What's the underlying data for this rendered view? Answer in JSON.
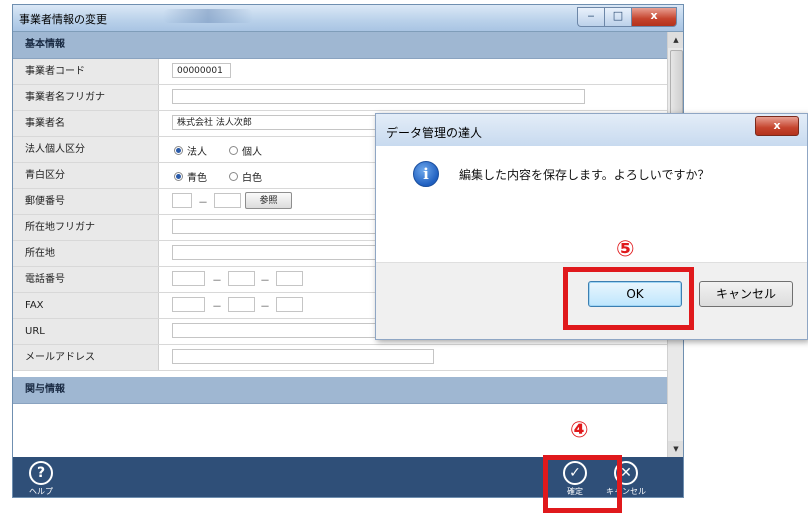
{
  "window": {
    "title": "事業者情報の変更",
    "buttons": {
      "minimize": "‒",
      "maximize": "□",
      "close": "x"
    }
  },
  "sections": {
    "basic": "基本情報",
    "kanyo": "関与情報"
  },
  "fields": {
    "code": {
      "label": "事業者コード",
      "value": "00000001"
    },
    "kana": {
      "label": "事業者名フリガナ",
      "value": ""
    },
    "name": {
      "label": "事業者名",
      "value": "株式会社 法人次郎"
    },
    "type": {
      "label": "法人個人区分",
      "opt1": "法人",
      "opt2": "個人"
    },
    "color": {
      "label": "青白区分",
      "opt1": "青色",
      "opt2": "白色"
    },
    "zip": {
      "label": "郵便番号",
      "dash": "－",
      "button": "参照"
    },
    "addr_kana": {
      "label": "所在地フリガナ"
    },
    "addr": {
      "label": "所在地"
    },
    "tel": {
      "label": "電話番号",
      "dash": "－"
    },
    "fax": {
      "label": "FAX",
      "dash": "－"
    },
    "url": {
      "label": "URL"
    },
    "email": {
      "label": "メールアドレス"
    }
  },
  "bottom_bar": {
    "help": "ヘルプ",
    "help_icon": "?",
    "confirm": "確定",
    "confirm_icon": "✓",
    "cancel": "キャンセル",
    "cancel_icon": "✕"
  },
  "dialog": {
    "title": "データ管理の達人",
    "close": "x",
    "icon": "i",
    "message": "編集した内容を保存します。よろしいですか？",
    "ok": "OK",
    "cancel": "キャンセル"
  },
  "annotations": {
    "step4": "④",
    "step5": "⑤"
  },
  "colors": {
    "highlight": "#e0191c",
    "bottom_bar": "#2f4f78",
    "section": "#9fb7d2"
  }
}
